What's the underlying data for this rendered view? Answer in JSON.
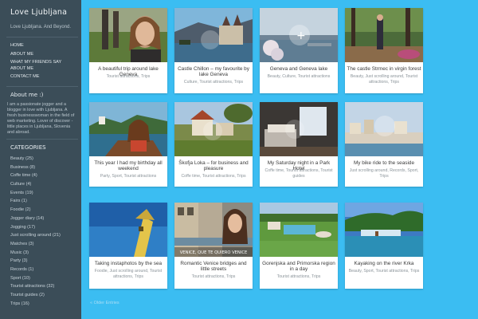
{
  "site": {
    "title": "Love Ljubljana",
    "tagline": "Love Ljubljana. And Beyond."
  },
  "nav": [
    "Home",
    "About me",
    "What my friends say about me",
    "Contact me"
  ],
  "about": {
    "heading": "About me :)",
    "text": "I am a passionate jogger and a blogger in love with Ljubljana. A fresh businesswoman in the field of web marketing. Lover of discover - little places in Ljubljana, Slovenia and abroad."
  },
  "categories": {
    "heading": "Categories",
    "items": [
      "Beauty (25)",
      "Business (8)",
      "Coffe time (4)",
      "Culture (4)",
      "Events (19)",
      "Fairs (1)",
      "Foodie (2)",
      "Jogger diary (14)",
      "Jogging (17)",
      "Just scrolling around (21)",
      "Matches (3)",
      "Music (3)",
      "Party (3)",
      "Records (1)",
      "Sport (10)",
      "Tourist attractions (32)",
      "Tourist guides (2)",
      "Trips (16)"
    ]
  },
  "posts": [
    {
      "title": "A beautiful trip around lake Geneva",
      "tags": "Tourist attractions, Trips"
    },
    {
      "title": "Castle Chillon – my favourite by lake Geneva",
      "tags": "Culture, Tourist attractions, Trips"
    },
    {
      "title": "Geneva and Geneva lake",
      "tags": "Beauty, Culture, Tourist attractions"
    },
    {
      "title": "The castle Strmec in virgin forest",
      "tags": "Beauty, Just scrolling around, Tourist attractions, Trips"
    },
    {
      "title": "This year I had my birthday all weekend",
      "tags": "Party, Sport, Tourist attractions"
    },
    {
      "title": "Škofja Loka – for business and pleasure",
      "tags": "Coffe time, Tourist attractions, Trips"
    },
    {
      "title": "My Saturday night in a Park Hotel",
      "tags": "Coffe time, Tourist attractions, Tourist guides"
    },
    {
      "title": "My bike ride to the seaside",
      "tags": "Just scrolling around, Records, Sport, Trips"
    },
    {
      "title": "Taking instaphotos by the sea",
      "tags": "Foodie, Just scrolling around, Tourist attractions, Trips"
    },
    {
      "title": "Romantic Venice bridges and little streets",
      "tags": "Tourist attractions, Trips"
    },
    {
      "title": "Gorenjska and Primorska region in a day",
      "tags": "Tourist attractions, Trips"
    },
    {
      "title": "Kayaking on the river Krka",
      "tags": "Beauty, Sport, Tourist attractions, Trips"
    }
  ],
  "photo_caption": "VENICE, QUE TE QUIERO VENICE",
  "footer_link": "« Older Entries",
  "colors": {
    "page_bg": "#3bbdf2",
    "sidebar_bg": "#3b4d58",
    "card_bg": "#ffffff"
  }
}
